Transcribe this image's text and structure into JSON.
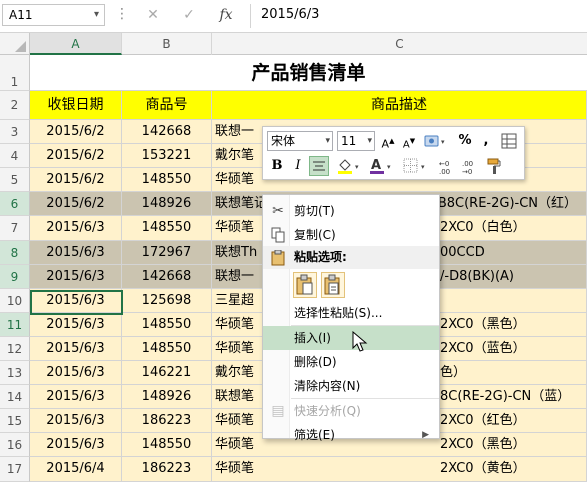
{
  "name_box": "A11",
  "formula_value": "2015/6/3",
  "formula_buttons": {
    "cancel": "✕",
    "enter": "✓",
    "fx": "fx"
  },
  "columns": [
    "A",
    "B",
    "C"
  ],
  "title": "产品销售清单",
  "headers": {
    "date": "收银日期",
    "code": "商品号",
    "desc": "商品描述"
  },
  "rows": [
    {
      "num": "3",
      "date": "2015/6/2",
      "code": "142668",
      "desc": "联想一"
    },
    {
      "num": "4",
      "date": "2015/6/2",
      "code": "153221",
      "desc": "戴尔笔"
    },
    {
      "num": "5",
      "date": "2015/6/2",
      "code": "148550",
      "desc": "华硕笔"
    },
    {
      "num": "6",
      "date": "2015/6/2",
      "code": "148926",
      "desc": "联想笔记本M4450AA105750M4G1TB8C(RE-2G)-CN（红）"
    },
    {
      "num": "7",
      "date": "2015/6/3",
      "code": "148550",
      "desc": "华硕笔",
      "tail": "2XC0（白色）"
    },
    {
      "num": "8",
      "date": "2015/6/3",
      "code": "172967",
      "desc": "联想Th",
      "tail": "00CCD"
    },
    {
      "num": "9",
      "date": "2015/6/3",
      "code": "142668",
      "desc": "联想一",
      "tail": "/-D8(BK)(A)"
    },
    {
      "num": "10",
      "date": "2015/6/3",
      "code": "125698",
      "desc": "三星超"
    },
    {
      "num": "11",
      "date": "2015/6/3",
      "code": "148550",
      "desc": "华硕笔",
      "tail": "2XC0（黑色）"
    },
    {
      "num": "12",
      "date": "2015/6/3",
      "code": "148550",
      "desc": "华硕笔",
      "tail": "2XC0（蓝色）"
    },
    {
      "num": "13",
      "date": "2015/6/3",
      "code": "146221",
      "desc": "戴尔笔",
      "tail": "色）"
    },
    {
      "num": "14",
      "date": "2015/6/3",
      "code": "148926",
      "desc": "联想笔",
      "tail": "8C(RE-2G)-CN（蓝）"
    },
    {
      "num": "15",
      "date": "2015/6/3",
      "code": "186223",
      "desc": "华硕笔",
      "tail": "2XC0（红色）"
    },
    {
      "num": "16",
      "date": "2015/6/3",
      "code": "148550",
      "desc": "华硕笔",
      "tail": "2XC0（黑色）"
    },
    {
      "num": "17",
      "date": "2015/6/4",
      "code": "186223",
      "desc": "华硕笔",
      "tail": "2XC0（黄色）"
    }
  ],
  "mini_toolbar": {
    "font": "宋体",
    "size": "11",
    "percent": "%",
    "comma": ",",
    "bold": "B",
    "italic": "I",
    "font_color": "A"
  },
  "context_menu": {
    "cut": "剪切(T)",
    "copy": "复制(C)",
    "paste_options": "粘贴选项:",
    "paste_special": "选择性粘贴(S)...",
    "insert": "插入(I)",
    "delete": "删除(D)",
    "clear": "清除内容(N)",
    "quick_analysis": "快速分析(Q)",
    "filter": "筛选(E)"
  },
  "colors": {
    "accent": "#217346",
    "header_fill": "#ffff00",
    "band_fill": "#fff2cc",
    "selected_row_fill": "#cbc4b0",
    "menu_highlight": "#c6e0c9"
  }
}
